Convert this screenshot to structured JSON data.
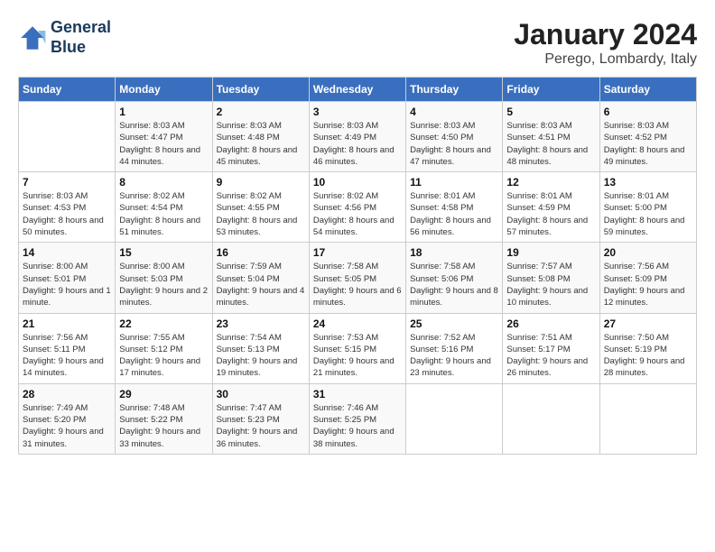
{
  "header": {
    "logo_line1": "General",
    "logo_line2": "Blue",
    "title": "January 2024",
    "subtitle": "Perego, Lombardy, Italy"
  },
  "weekdays": [
    "Sunday",
    "Monday",
    "Tuesday",
    "Wednesday",
    "Thursday",
    "Friday",
    "Saturday"
  ],
  "weeks": [
    [
      {
        "day": "",
        "sunrise": "",
        "sunset": "",
        "daylight": "",
        "empty": true
      },
      {
        "day": "1",
        "sunrise": "Sunrise: 8:03 AM",
        "sunset": "Sunset: 4:47 PM",
        "daylight": "Daylight: 8 hours and 44 minutes."
      },
      {
        "day": "2",
        "sunrise": "Sunrise: 8:03 AM",
        "sunset": "Sunset: 4:48 PM",
        "daylight": "Daylight: 8 hours and 45 minutes."
      },
      {
        "day": "3",
        "sunrise": "Sunrise: 8:03 AM",
        "sunset": "Sunset: 4:49 PM",
        "daylight": "Daylight: 8 hours and 46 minutes."
      },
      {
        "day": "4",
        "sunrise": "Sunrise: 8:03 AM",
        "sunset": "Sunset: 4:50 PM",
        "daylight": "Daylight: 8 hours and 47 minutes."
      },
      {
        "day": "5",
        "sunrise": "Sunrise: 8:03 AM",
        "sunset": "Sunset: 4:51 PM",
        "daylight": "Daylight: 8 hours and 48 minutes."
      },
      {
        "day": "6",
        "sunrise": "Sunrise: 8:03 AM",
        "sunset": "Sunset: 4:52 PM",
        "daylight": "Daylight: 8 hours and 49 minutes."
      }
    ],
    [
      {
        "day": "7",
        "sunrise": "Sunrise: 8:03 AM",
        "sunset": "Sunset: 4:53 PM",
        "daylight": "Daylight: 8 hours and 50 minutes."
      },
      {
        "day": "8",
        "sunrise": "Sunrise: 8:02 AM",
        "sunset": "Sunset: 4:54 PM",
        "daylight": "Daylight: 8 hours and 51 minutes."
      },
      {
        "day": "9",
        "sunrise": "Sunrise: 8:02 AM",
        "sunset": "Sunset: 4:55 PM",
        "daylight": "Daylight: 8 hours and 53 minutes."
      },
      {
        "day": "10",
        "sunrise": "Sunrise: 8:02 AM",
        "sunset": "Sunset: 4:56 PM",
        "daylight": "Daylight: 8 hours and 54 minutes."
      },
      {
        "day": "11",
        "sunrise": "Sunrise: 8:01 AM",
        "sunset": "Sunset: 4:58 PM",
        "daylight": "Daylight: 8 hours and 56 minutes."
      },
      {
        "day": "12",
        "sunrise": "Sunrise: 8:01 AM",
        "sunset": "Sunset: 4:59 PM",
        "daylight": "Daylight: 8 hours and 57 minutes."
      },
      {
        "day": "13",
        "sunrise": "Sunrise: 8:01 AM",
        "sunset": "Sunset: 5:00 PM",
        "daylight": "Daylight: 8 hours and 59 minutes."
      }
    ],
    [
      {
        "day": "14",
        "sunrise": "Sunrise: 8:00 AM",
        "sunset": "Sunset: 5:01 PM",
        "daylight": "Daylight: 9 hours and 1 minute."
      },
      {
        "day": "15",
        "sunrise": "Sunrise: 8:00 AM",
        "sunset": "Sunset: 5:03 PM",
        "daylight": "Daylight: 9 hours and 2 minutes."
      },
      {
        "day": "16",
        "sunrise": "Sunrise: 7:59 AM",
        "sunset": "Sunset: 5:04 PM",
        "daylight": "Daylight: 9 hours and 4 minutes."
      },
      {
        "day": "17",
        "sunrise": "Sunrise: 7:58 AM",
        "sunset": "Sunset: 5:05 PM",
        "daylight": "Daylight: 9 hours and 6 minutes."
      },
      {
        "day": "18",
        "sunrise": "Sunrise: 7:58 AM",
        "sunset": "Sunset: 5:06 PM",
        "daylight": "Daylight: 9 hours and 8 minutes."
      },
      {
        "day": "19",
        "sunrise": "Sunrise: 7:57 AM",
        "sunset": "Sunset: 5:08 PM",
        "daylight": "Daylight: 9 hours and 10 minutes."
      },
      {
        "day": "20",
        "sunrise": "Sunrise: 7:56 AM",
        "sunset": "Sunset: 5:09 PM",
        "daylight": "Daylight: 9 hours and 12 minutes."
      }
    ],
    [
      {
        "day": "21",
        "sunrise": "Sunrise: 7:56 AM",
        "sunset": "Sunset: 5:11 PM",
        "daylight": "Daylight: 9 hours and 14 minutes."
      },
      {
        "day": "22",
        "sunrise": "Sunrise: 7:55 AM",
        "sunset": "Sunset: 5:12 PM",
        "daylight": "Daylight: 9 hours and 17 minutes."
      },
      {
        "day": "23",
        "sunrise": "Sunrise: 7:54 AM",
        "sunset": "Sunset: 5:13 PM",
        "daylight": "Daylight: 9 hours and 19 minutes."
      },
      {
        "day": "24",
        "sunrise": "Sunrise: 7:53 AM",
        "sunset": "Sunset: 5:15 PM",
        "daylight": "Daylight: 9 hours and 21 minutes."
      },
      {
        "day": "25",
        "sunrise": "Sunrise: 7:52 AM",
        "sunset": "Sunset: 5:16 PM",
        "daylight": "Daylight: 9 hours and 23 minutes."
      },
      {
        "day": "26",
        "sunrise": "Sunrise: 7:51 AM",
        "sunset": "Sunset: 5:17 PM",
        "daylight": "Daylight: 9 hours and 26 minutes."
      },
      {
        "day": "27",
        "sunrise": "Sunrise: 7:50 AM",
        "sunset": "Sunset: 5:19 PM",
        "daylight": "Daylight: 9 hours and 28 minutes."
      }
    ],
    [
      {
        "day": "28",
        "sunrise": "Sunrise: 7:49 AM",
        "sunset": "Sunset: 5:20 PM",
        "daylight": "Daylight: 9 hours and 31 minutes."
      },
      {
        "day": "29",
        "sunrise": "Sunrise: 7:48 AM",
        "sunset": "Sunset: 5:22 PM",
        "daylight": "Daylight: 9 hours and 33 minutes."
      },
      {
        "day": "30",
        "sunrise": "Sunrise: 7:47 AM",
        "sunset": "Sunset: 5:23 PM",
        "daylight": "Daylight: 9 hours and 36 minutes."
      },
      {
        "day": "31",
        "sunrise": "Sunrise: 7:46 AM",
        "sunset": "Sunset: 5:25 PM",
        "daylight": "Daylight: 9 hours and 38 minutes."
      },
      {
        "day": "",
        "sunrise": "",
        "sunset": "",
        "daylight": "",
        "empty": true
      },
      {
        "day": "",
        "sunrise": "",
        "sunset": "",
        "daylight": "",
        "empty": true
      },
      {
        "day": "",
        "sunrise": "",
        "sunset": "",
        "daylight": "",
        "empty": true
      }
    ]
  ]
}
